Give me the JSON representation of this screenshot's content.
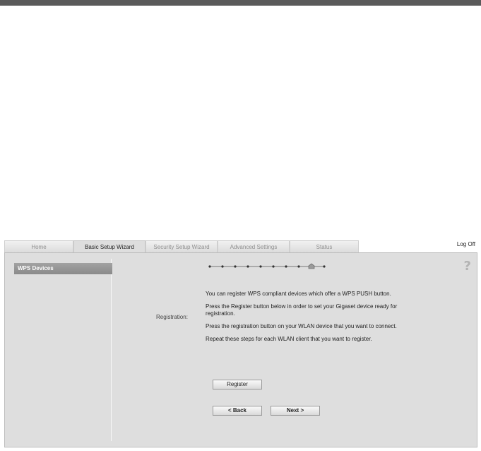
{
  "tabs": [
    {
      "label": "Home"
    },
    {
      "label": "Basic Setup Wizard"
    },
    {
      "label": "Security Setup Wizard"
    },
    {
      "label": "Advanced Settings"
    },
    {
      "label": "Status"
    }
  ],
  "header": {
    "logoff": "Log Off"
  },
  "sidebar": {
    "items": [
      {
        "label": "WPS Devices"
      }
    ]
  },
  "help": {
    "symbol": "?"
  },
  "wizard": {
    "steps_total": 10,
    "current_step": 9
  },
  "registration": {
    "label": "Registration:",
    "paragraphs": [
      "You can register WPS compliant devices which offer a WPS PUSH button.",
      "Press the Register button below in order to set your Gigaset device ready for registration.",
      "Press the registration button on your WLAN device that you want to connect.",
      "Repeat these steps for each WLAN client that you want to register."
    ]
  },
  "buttons": {
    "register": "Register",
    "back": "< Back",
    "next": "Next >"
  }
}
